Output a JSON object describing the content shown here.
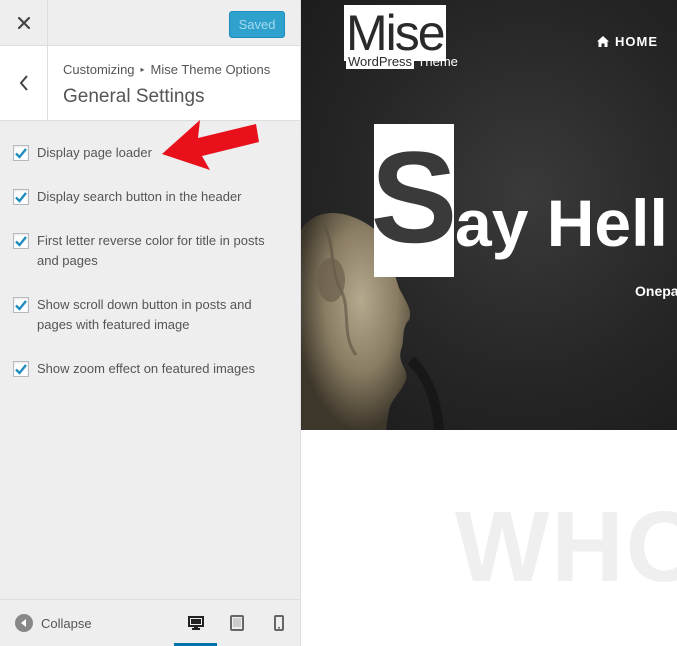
{
  "topbar": {
    "close_icon": "close-icon",
    "saved_label": "Saved"
  },
  "section": {
    "breadcrumb_root": "Customizing",
    "breadcrumb_current": "Mise Theme Options",
    "title": "General Settings"
  },
  "options": [
    {
      "label": "Display page loader",
      "checked": true
    },
    {
      "label": "Display search button in the header",
      "checked": true
    },
    {
      "label": "First letter reverse color for title in posts and pages",
      "checked": true
    },
    {
      "label": "Show scroll down button in posts and pages with featured image",
      "checked": true
    },
    {
      "label": "Show zoom effect on featured images",
      "checked": true
    }
  ],
  "annotation": {
    "icon": "red-arrow-icon",
    "color": "#e8101b"
  },
  "footer": {
    "collapse_label": "Collapse",
    "devices": [
      "desktop-icon",
      "tablet-icon",
      "mobile-icon"
    ],
    "active_device": "desktop"
  },
  "preview": {
    "logo_main": "Mise",
    "logo_sub_wp": "WordPress",
    "logo_sub_rest": " Theme",
    "nav_home": "HOME",
    "hero_first_letter": "S",
    "hero_title_rest": "ay Hell",
    "hero_subtitle": "Onepa",
    "section_heading": "WHO"
  },
  "colors": {
    "accent": "#2ea2cc",
    "checkmark": "#1e8cbe",
    "active_device": "#0073aa"
  }
}
